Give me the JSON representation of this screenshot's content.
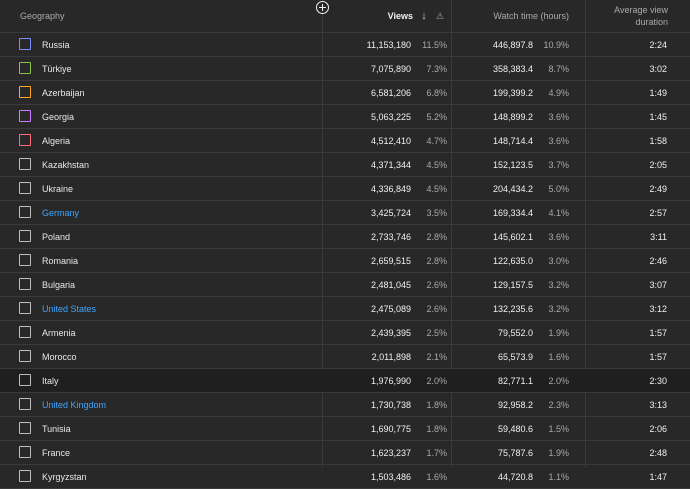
{
  "header": {
    "geography": "Geography",
    "views": "Views",
    "sort_icon": "↓",
    "warning_icon": "⚠",
    "watch_time": "Watch time (hours)",
    "avg_duration": "Average view duration"
  },
  "rows": [
    {
      "name": "Russia",
      "views": "11,153,180",
      "vpct": "11.5%",
      "watch": "446,897.8",
      "wpct": "10.9%",
      "avd": "2:24",
      "color": "#7b8cff",
      "link": false
    },
    {
      "name": "Türkiye",
      "views": "7,075,890",
      "vpct": "7.3%",
      "watch": "358,383.4",
      "wpct": "8.7%",
      "avd": "3:02",
      "color": "#8bc34a",
      "link": false
    },
    {
      "name": "Azerbaijan",
      "views": "6,581,206",
      "vpct": "6.8%",
      "watch": "199,399.2",
      "wpct": "4.9%",
      "avd": "1:49",
      "color": "#ffa726",
      "link": false
    },
    {
      "name": "Georgia",
      "views": "5,063,225",
      "vpct": "5.2%",
      "watch": "148,899.2",
      "wpct": "3.6%",
      "avd": "1:45",
      "color": "#ce7bff",
      "link": false
    },
    {
      "name": "Algeria",
      "views": "4,512,410",
      "vpct": "4.7%",
      "watch": "148,714.4",
      "wpct": "3.6%",
      "avd": "1:58",
      "color": "#ff6b7a",
      "link": false
    },
    {
      "name": "Kazakhstan",
      "views": "4,371,344",
      "vpct": "4.5%",
      "watch": "152,123.5",
      "wpct": "3.7%",
      "avd": "2:05",
      "color": "#bdbdbd",
      "link": false
    },
    {
      "name": "Ukraine",
      "views": "4,336,849",
      "vpct": "4.5%",
      "watch": "204,434.2",
      "wpct": "5.0%",
      "avd": "2:49",
      "color": "#bdbdbd",
      "link": false
    },
    {
      "name": "Germany",
      "views": "3,425,724",
      "vpct": "3.5%",
      "watch": "169,334.4",
      "wpct": "4.1%",
      "avd": "2:57",
      "color": "#bdbdbd",
      "link": true
    },
    {
      "name": "Poland",
      "views": "2,733,746",
      "vpct": "2.8%",
      "watch": "145,602.1",
      "wpct": "3.6%",
      "avd": "3:11",
      "color": "#bdbdbd",
      "link": false
    },
    {
      "name": "Romania",
      "views": "2,659,515",
      "vpct": "2.8%",
      "watch": "122,635.0",
      "wpct": "3.0%",
      "avd": "2:46",
      "color": "#bdbdbd",
      "link": false
    },
    {
      "name": "Bulgaria",
      "views": "2,481,045",
      "vpct": "2.6%",
      "watch": "129,157.5",
      "wpct": "3.2%",
      "avd": "3:07",
      "color": "#bdbdbd",
      "link": false
    },
    {
      "name": "United States",
      "views": "2,475,089",
      "vpct": "2.6%",
      "watch": "132,235.6",
      "wpct": "3.2%",
      "avd": "3:12",
      "color": "#bdbdbd",
      "link": true
    },
    {
      "name": "Armenia",
      "views": "2,439,395",
      "vpct": "2.5%",
      "watch": "79,552.0",
      "wpct": "1.9%",
      "avd": "1:57",
      "color": "#bdbdbd",
      "link": false
    },
    {
      "name": "Morocco",
      "views": "2,011,898",
      "vpct": "2.1%",
      "watch": "65,573.9",
      "wpct": "1.6%",
      "avd": "1:57",
      "color": "#bdbdbd",
      "link": false
    },
    {
      "name": "Italy",
      "views": "1,976,990",
      "vpct": "2.0%",
      "watch": "82,771.1",
      "wpct": "2.0%",
      "avd": "2:30",
      "color": "#bdbdbd",
      "link": false,
      "highlight": true
    },
    {
      "name": "United Kingdom",
      "views": "1,730,738",
      "vpct": "1.8%",
      "watch": "92,958.2",
      "wpct": "2.3%",
      "avd": "3:13",
      "color": "#bdbdbd",
      "link": true
    },
    {
      "name": "Tunisia",
      "views": "1,690,775",
      "vpct": "1.8%",
      "watch": "59,480.6",
      "wpct": "1.5%",
      "avd": "2:06",
      "color": "#bdbdbd",
      "link": false
    },
    {
      "name": "France",
      "views": "1,623,237",
      "vpct": "1.7%",
      "watch": "75,787.6",
      "wpct": "1.9%",
      "avd": "2:48",
      "color": "#bdbdbd",
      "link": false
    },
    {
      "name": "Kyrgyzstan",
      "views": "1,503,486",
      "vpct": "1.6%",
      "watch": "44,720.8",
      "wpct": "1.1%",
      "avd": "1:47",
      "color": "#bdbdbd",
      "link": false
    }
  ]
}
